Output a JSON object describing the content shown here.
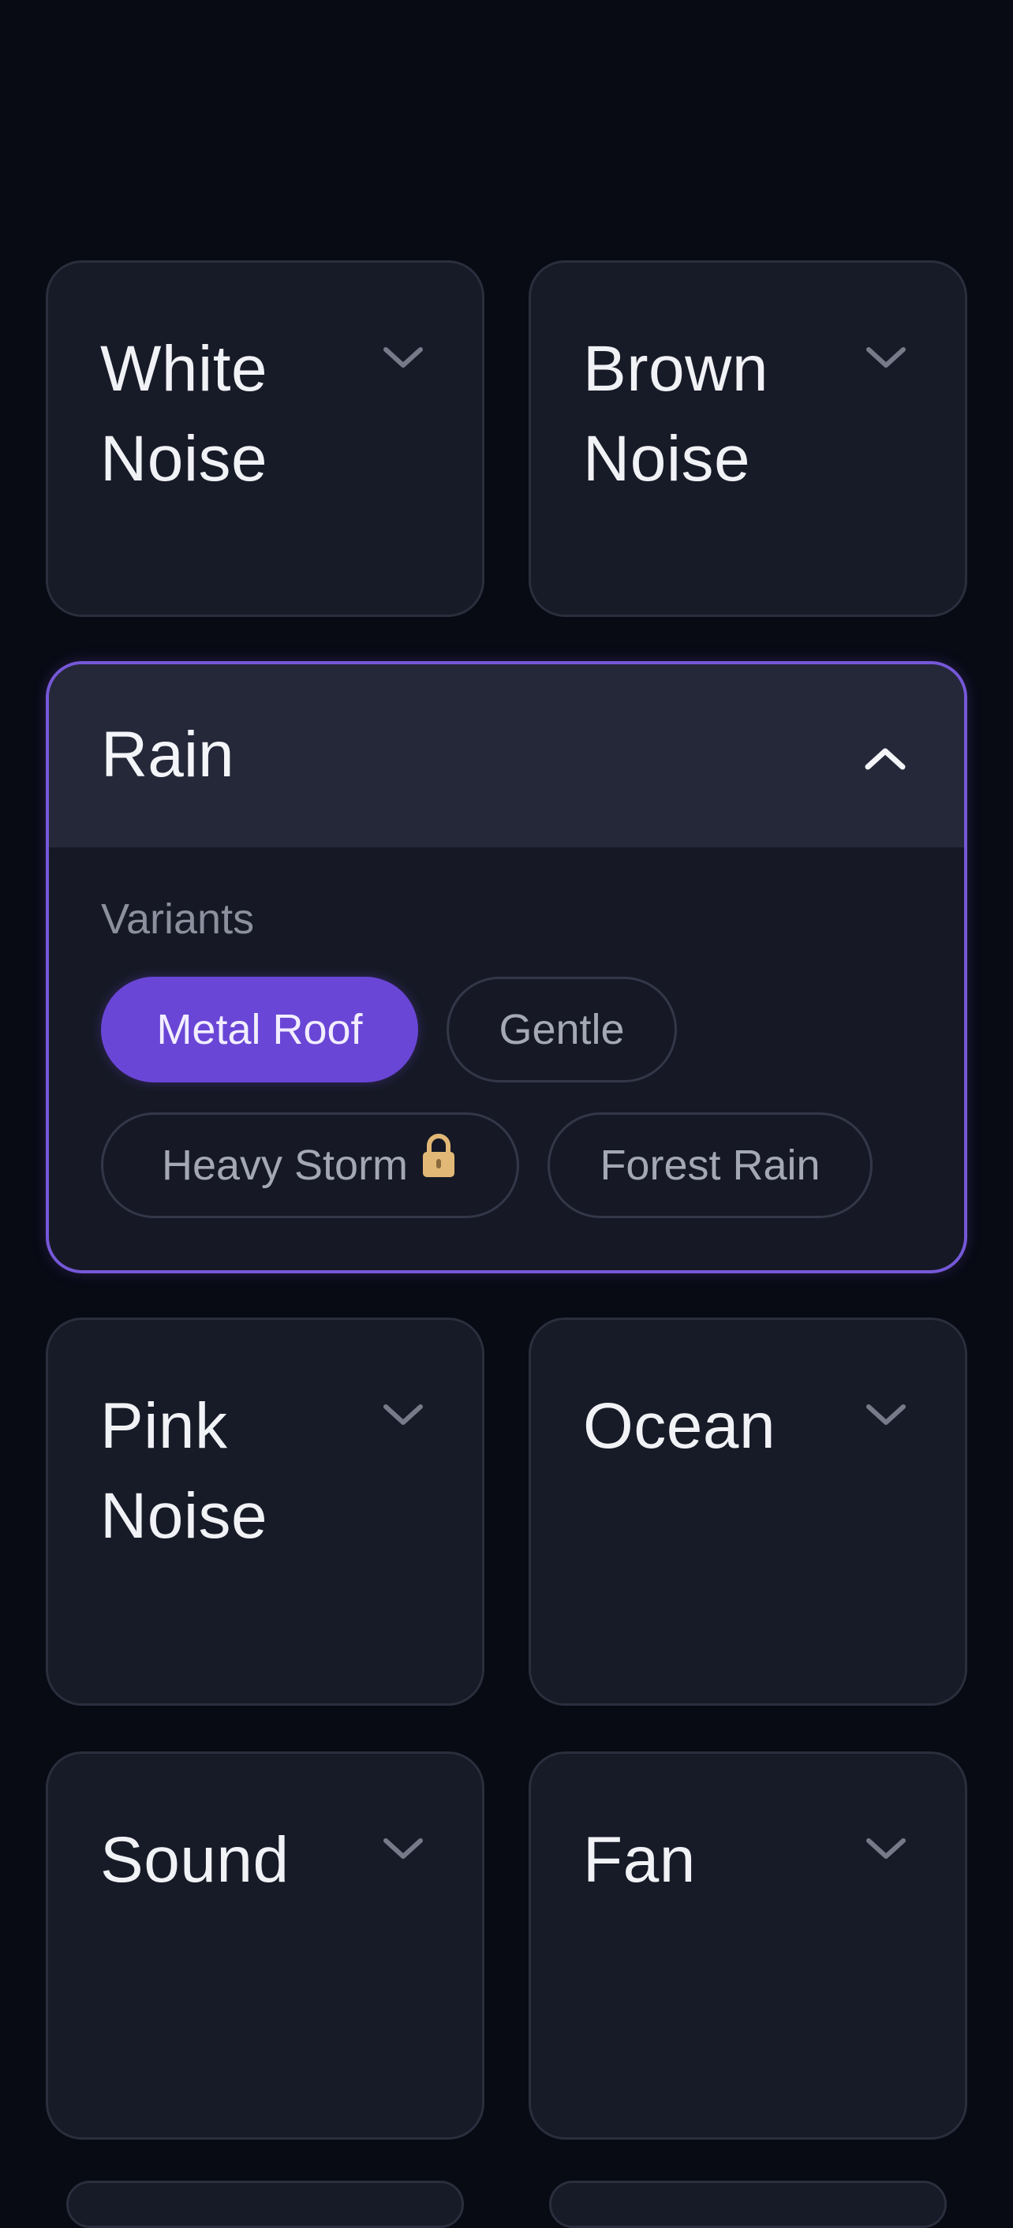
{
  "cards_top": [
    {
      "title": "White\nNoise",
      "icon": "chevron-down-icon"
    },
    {
      "title": "Brown\nNoise",
      "icon": "chevron-down-icon"
    }
  ],
  "expanded": {
    "title": "Rain",
    "icon": "chevron-up-icon",
    "variants_label": "Variants",
    "variants": [
      {
        "label": "Metal Roof",
        "selected": true,
        "locked": false
      },
      {
        "label": "Gentle",
        "selected": false,
        "locked": false
      },
      {
        "label": "Heavy Storm",
        "selected": false,
        "locked": true
      },
      {
        "label": "Forest Rain",
        "selected": false,
        "locked": false
      }
    ]
  },
  "cards_middle": [
    {
      "title": "Pink\nNoise",
      "icon": "chevron-down-icon"
    },
    {
      "title": "Ocean",
      "icon": "chevron-down-icon"
    }
  ],
  "cards_bottom": [
    {
      "title": "Sound",
      "icon": "chevron-down-icon"
    },
    {
      "title": "Fan",
      "icon": "chevron-down-icon"
    }
  ],
  "colors": {
    "background": "#080a14",
    "card": "#171a27",
    "card_border": "#2a2e3d",
    "accent": "#6a46d6",
    "lock": "#e2b877"
  }
}
